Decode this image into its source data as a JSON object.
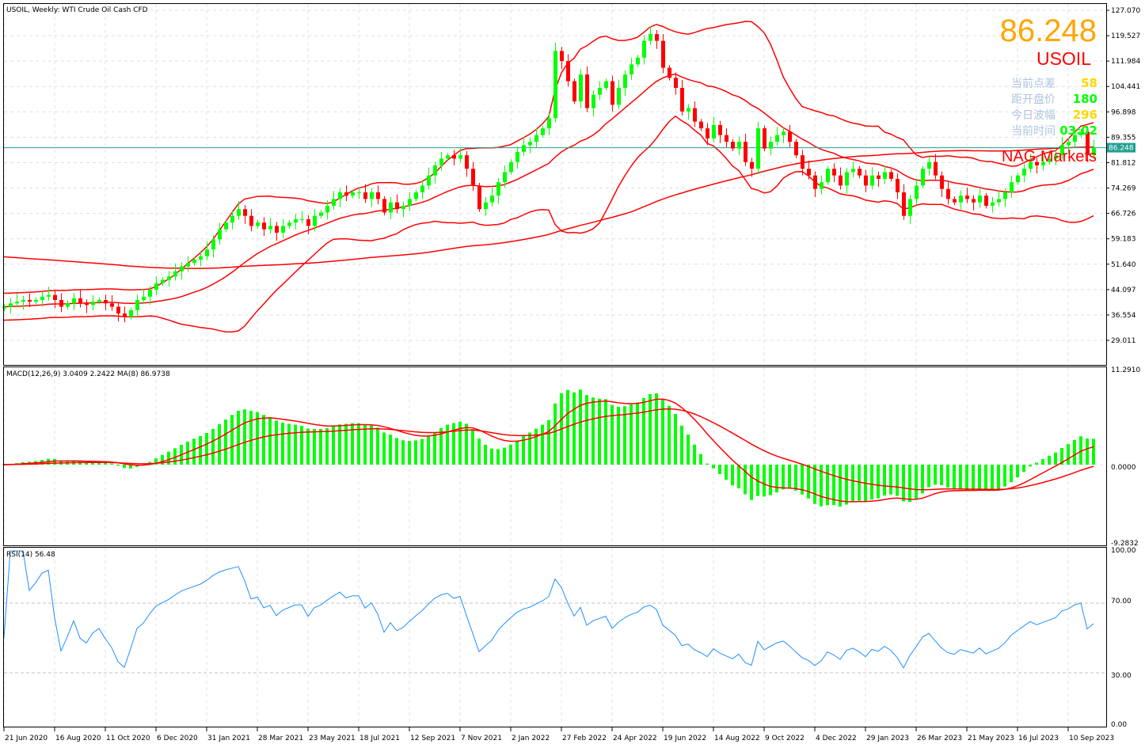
{
  "window": {
    "title": "USOIL, Weekly:  WTI Crude Oil Cash CFD"
  },
  "info_panel": {
    "price": "86.248",
    "symbol": "USOIL",
    "rows": [
      {
        "label": "当前点差",
        "value": "58",
        "color": "#ffd700"
      },
      {
        "label": "距开盘价",
        "value": "180",
        "color": "#00ff00"
      },
      {
        "label": "今日波幅",
        "value": "296",
        "color": "#ffd700"
      },
      {
        "label": "当前时间",
        "value": "03:02",
        "color": "#00ff00"
      }
    ],
    "broker": "NAG Markets"
  },
  "price_axis": {
    "labels": [
      "127.070",
      "119.527",
      "111.984",
      "104.441",
      "96.898",
      "89.355",
      "81.812",
      "74.269",
      "66.726",
      "59.183",
      "51.640",
      "44.097",
      "36.554",
      "29.011"
    ],
    "current_price_label": "86.248"
  },
  "macd_panel": {
    "title": "MACD(12,26,9) 3.0409 2.2422 MA(8) 86.9738",
    "axis_labels": [
      "11.2910",
      "0.0000",
      "-9.2832"
    ]
  },
  "rsi_panel": {
    "title": "RSI(14) 56.48",
    "axis_labels": [
      "100.00",
      "70.00",
      "30.00",
      "0.00"
    ]
  },
  "time_axis": {
    "labels": [
      "21 Jun 2020",
      "16 Aug 2020",
      "11 Oct 2020",
      "6 Dec 2020",
      "31 Jan 2021",
      "28 Mar 2021",
      "23 May 2021",
      "18 Jul 2021",
      "12 Sep 2021",
      "7 Nov 2021",
      "2 Jan 2022",
      "27 Feb 2022",
      "24 Apr 2022",
      "19 Jun 2022",
      "14 Aug 2022",
      "9 Oct 2022",
      "4 Dec 2022",
      "29 Jan 2023",
      "26 Mar 2023",
      "21 May 2023",
      "16 Jul 2023",
      "10 Sep 2023"
    ]
  },
  "colors": {
    "bull": "#00ff00",
    "bear": "#ff0000",
    "indicator": "#ff0000",
    "rsi": "#1e90ff",
    "current_price_line": "#20a090",
    "price_big": "#ffa500",
    "info_label": "#b0c4de"
  },
  "chart_data": {
    "type": "candlestick",
    "timeframe": "Weekly",
    "symbol": "USOIL",
    "ylim": [
      29.011,
      127.07
    ],
    "closes": [
      39,
      40,
      40.5,
      41,
      40.5,
      41,
      42,
      42.5,
      41,
      39,
      40,
      41.5,
      40,
      39.5,
      40.5,
      41,
      40,
      39,
      37,
      36,
      38,
      41,
      42,
      44,
      46,
      47,
      48,
      49.5,
      51,
      52,
      53,
      54,
      56,
      59,
      62,
      64,
      66,
      68,
      66,
      63,
      64,
      62,
      63,
      61,
      63,
      64,
      65,
      65,
      63,
      66,
      67,
      69,
      71,
      73,
      72,
      73,
      73,
      71,
      73,
      71,
      67,
      70,
      68,
      69,
      71,
      73,
      75,
      78,
      81,
      83,
      84,
      83,
      84,
      80,
      75,
      68,
      70,
      72,
      76,
      79,
      82,
      85,
      87,
      88,
      90,
      92,
      95,
      115,
      112,
      106,
      100,
      108,
      98,
      102,
      104,
      106,
      99,
      104,
      108,
      111,
      113,
      118,
      120,
      118,
      110,
      107,
      104,
      97,
      98,
      94,
      92,
      89,
      93,
      90,
      88,
      86,
      88,
      82,
      80,
      92,
      86,
      88,
      90,
      91,
      88,
      84,
      80,
      78,
      74,
      76,
      80,
      78,
      75,
      79,
      80,
      78,
      75,
      78,
      77,
      79,
      77,
      73,
      66,
      71,
      75,
      80,
      82,
      78,
      74,
      71,
      70,
      72,
      71,
      70,
      72,
      69,
      70,
      71,
      73,
      76,
      78,
      80,
      82,
      81,
      82,
      83,
      84,
      87,
      88,
      90,
      91,
      84,
      86.248
    ],
    "current_price": 86.248,
    "macd": {
      "fast": 12,
      "slow": 26,
      "signal": 9,
      "main": 3.0409,
      "signal_value": 2.2422,
      "ma8": 86.9738,
      "ylim": [
        -9.2832,
        11.291
      ]
    },
    "rsi": {
      "period": 14,
      "value": 56.48,
      "levels": [
        70,
        30
      ],
      "ylim": [
        0,
        100
      ]
    }
  }
}
